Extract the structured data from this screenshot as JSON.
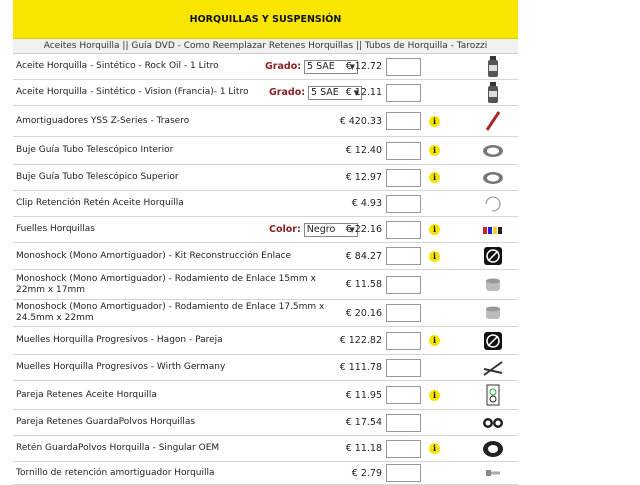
{
  "header": {
    "title": "HORQUILLAS Y SUSPENSIÓN"
  },
  "subnav": {
    "text": "Aceites Horquilla || Guía DVD - Como Reemplazar Retenes Horquillas || Tubos de Horquilla - Tarozzi"
  },
  "colors": {
    "header_bg": "#f8e600",
    "option_label": "#8a2020",
    "info_badge": "#f5e300"
  },
  "products": [
    {
      "name": "Aceite Horquilla - Sintético - Rock Oil - 1 Litro",
      "option_label": "Grado:",
      "option_value": "5 SAE",
      "price": "€ 12.72",
      "info": "",
      "thumb_icon": "oil-bottle-icon"
    },
    {
      "name": "Aceite Horquilla - Sintético - Vision (Francia)- 1 Litro",
      "option_label": "Grado:",
      "option_value": "5 SAE",
      "price": "€ 12.11",
      "info": "",
      "thumb_icon": "oil-bottle-icon"
    },
    {
      "name": "Amortiguadores YSS Z-Series - Trasero",
      "option_label": "",
      "option_value": "",
      "price": "€ 420.33",
      "info": "i",
      "thumb_icon": "shock-absorber-icon"
    },
    {
      "name": "Buje Guía Tubo Telescópico Interior",
      "option_label": "",
      "option_value": "",
      "price": "€ 12.40",
      "info": "i",
      "thumb_icon": "bushing-icon"
    },
    {
      "name": "Buje Guía Tubo Telescópico Superior",
      "option_label": "",
      "option_value": "",
      "price": "€ 12.97",
      "info": "i",
      "thumb_icon": "bushing-icon"
    },
    {
      "name": "Clip Retención Retén Aceite Horquilla",
      "option_label": "",
      "option_value": "",
      "price": "€ 4.93",
      "info": "",
      "thumb_icon": "clip-icon"
    },
    {
      "name": "Fuelles Horquillas",
      "option_label": "Color:",
      "option_value": "Negro",
      "price": "€ 22.16",
      "info": "i",
      "thumb_icon": "fork-gaiters-icon"
    },
    {
      "name": "Monoshock (Mono Amortiguador) - Kit Reconstrucción Enlace",
      "option_label": "",
      "option_value": "",
      "price": "€ 84.27",
      "info": "i",
      "thumb_icon": "no-photo-icon"
    },
    {
      "name": "Monoshock (Mono Amortiguador) - Rodamiento de Enlace 15mm x 22mm x 17mm",
      "option_label": "",
      "option_value": "",
      "price": "€ 11.58",
      "info": "",
      "thumb_icon": "bearing-icon"
    },
    {
      "name": "Monoshock (Mono Amortiguador) - Rodamiento de Enlace 17.5mm x 24.5mm x 22mm",
      "option_label": "",
      "option_value": "",
      "price": "€ 20.16",
      "info": "",
      "thumb_icon": "bearing-icon"
    },
    {
      "name": "Muelles Horquilla Progresivos - Hagon - Pareja",
      "option_label": "",
      "option_value": "",
      "price": "€ 122.82",
      "info": "i",
      "thumb_icon": "no-photo-icon"
    },
    {
      "name": "Muelles Horquilla Progresivos - Wirth Germany",
      "option_label": "",
      "option_value": "",
      "price": "€ 111.78",
      "info": "",
      "thumb_icon": "springs-icon"
    },
    {
      "name": "Pareja Retenes Aceite Horquilla",
      "option_label": "",
      "option_value": "",
      "price": "€ 11.95",
      "info": "i",
      "thumb_icon": "seal-kit-icon"
    },
    {
      "name": "Pareja Retenes GuardaPolvos Horquillas",
      "option_label": "",
      "option_value": "",
      "price": "€ 17.54",
      "info": "",
      "thumb_icon": "dust-seals-icon"
    },
    {
      "name": "Retén GuardaPolvos Horquilla - Singular OEM",
      "option_label": "",
      "option_value": "",
      "price": "€ 11.18",
      "info": "i",
      "thumb_icon": "dust-seal-icon"
    },
    {
      "name": "Tornillo de retención amortiguador Horquilla",
      "option_label": "",
      "option_value": "",
      "price": "€ 2.79",
      "info": "",
      "thumb_icon": "bolt-icon"
    }
  ]
}
